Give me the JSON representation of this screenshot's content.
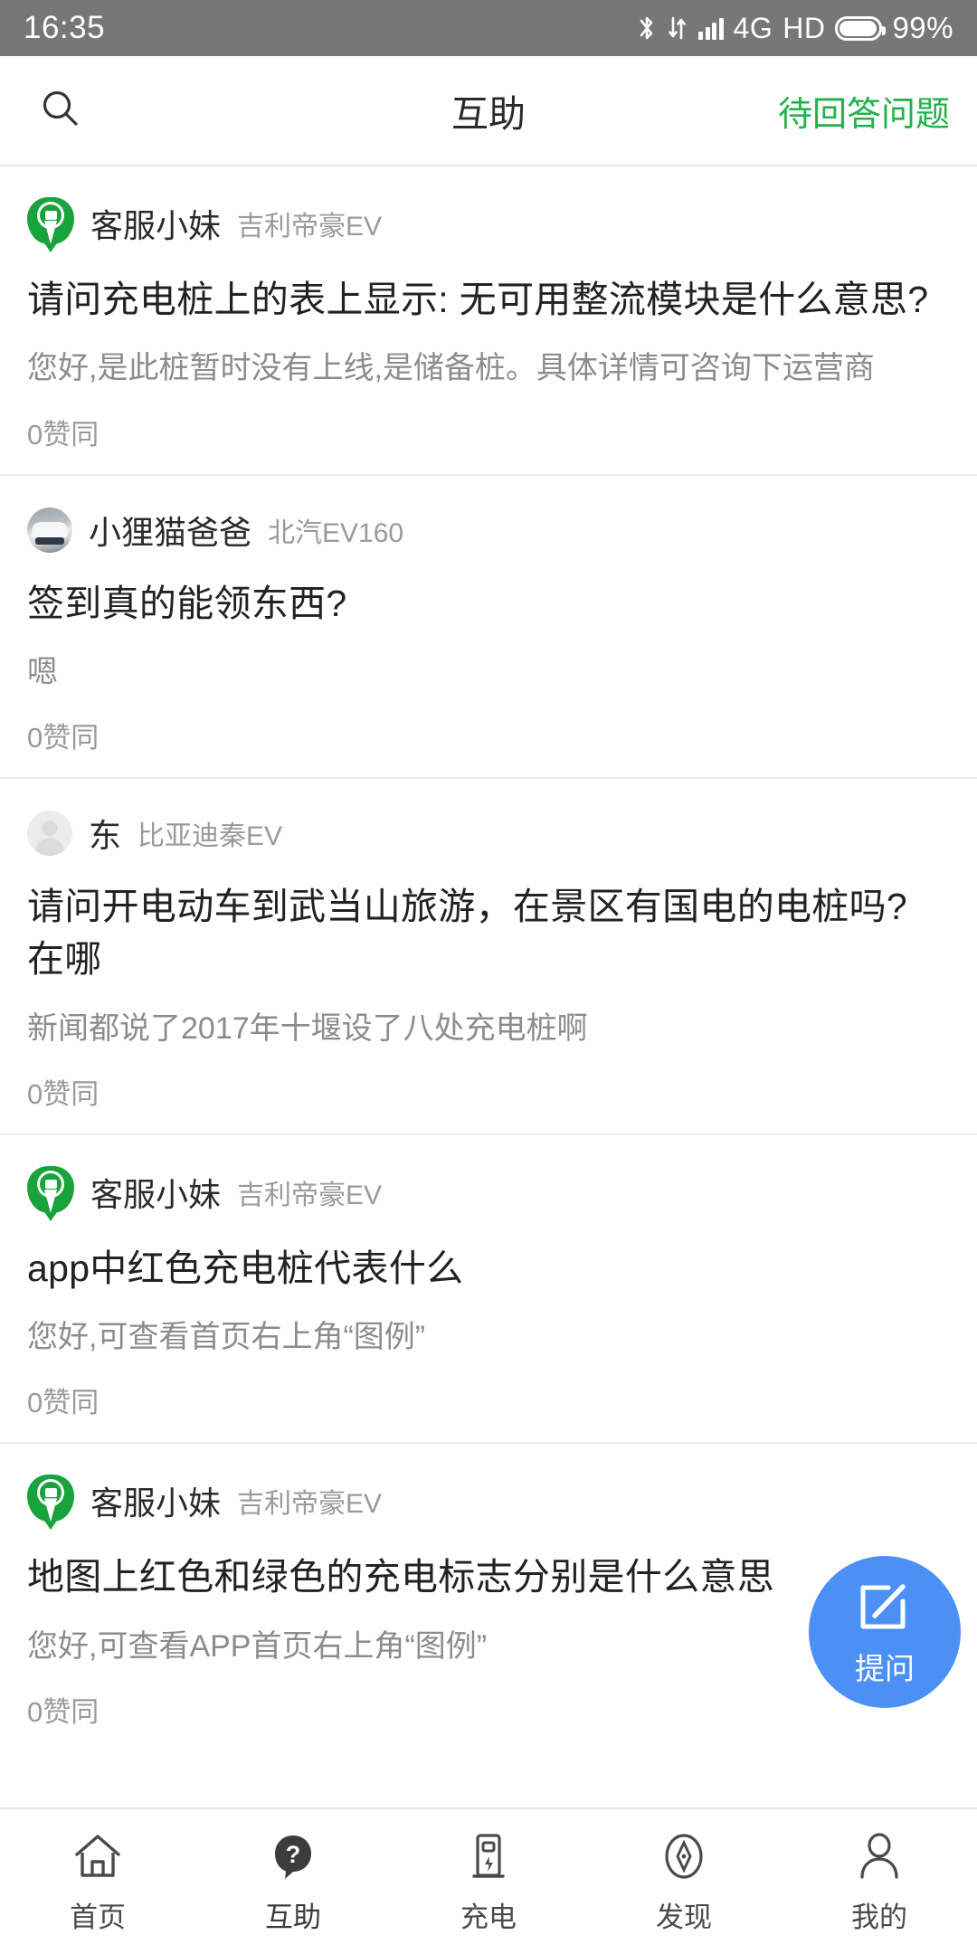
{
  "status_bar": {
    "time": "16:35",
    "network": "4G",
    "hd": "HD",
    "battery_percent": "99%",
    "icons": [
      "bluetooth-icon",
      "data-transfer-icon",
      "signal-bars-icon",
      "battery-icon"
    ]
  },
  "header": {
    "search_icon": "search-icon",
    "title": "互助",
    "action_label": "待回答问题",
    "accent_color": "#21b34a"
  },
  "feed": {
    "cards": [
      {
        "avatar_type": "green-pin-charging-icon",
        "user": "客服小妹",
        "car": "吉利帝豪EV",
        "question": "请问充电桩上的表上显示: 无可用整流模块是什么意思?",
        "answer": "您好,是此桩暂时没有上线,是储备桩。具体详情可咨询下运营商",
        "votes": "0赞同"
      },
      {
        "avatar_type": "car-photo",
        "user": "小狸猫爸爸",
        "car": "北汽EV160",
        "question": "签到真的能领东西?",
        "answer": "嗯",
        "votes": "0赞同"
      },
      {
        "avatar_type": "default-person-placeholder",
        "user": "东",
        "car": "比亚迪秦EV",
        "question": "请问开电动车到武当山旅游，在景区有国电的电桩吗? 在哪",
        "answer": "新闻都说了2017年十堰设了八处充电桩啊",
        "votes": "0赞同"
      },
      {
        "avatar_type": "green-pin-charging-icon",
        "user": "客服小妹",
        "car": "吉利帝豪EV",
        "question": "app中红色充电桩代表什么",
        "answer": "您好,可查看首页右上角“图例”",
        "votes": "0赞同"
      },
      {
        "avatar_type": "green-pin-charging-icon",
        "user": "客服小妹",
        "car": "吉利帝豪EV",
        "question": "地图上红色和绿色的充电标志分别是什么意思",
        "answer": "您好,可查看APP首页右上角“图例”",
        "votes": "0赞同"
      }
    ]
  },
  "fab": {
    "icon": "compose-icon",
    "label": "提问",
    "color": "#4a90f5"
  },
  "bottom_nav": {
    "items": [
      {
        "label": "首页",
        "icon": "home-icon",
        "active": false
      },
      {
        "label": "互助",
        "icon": "question-bubble-icon",
        "active": true
      },
      {
        "label": "充电",
        "icon": "charging-station-icon",
        "active": false
      },
      {
        "label": "发现",
        "icon": "compass-icon",
        "active": false
      },
      {
        "label": "我的",
        "icon": "person-icon",
        "active": false
      }
    ]
  }
}
